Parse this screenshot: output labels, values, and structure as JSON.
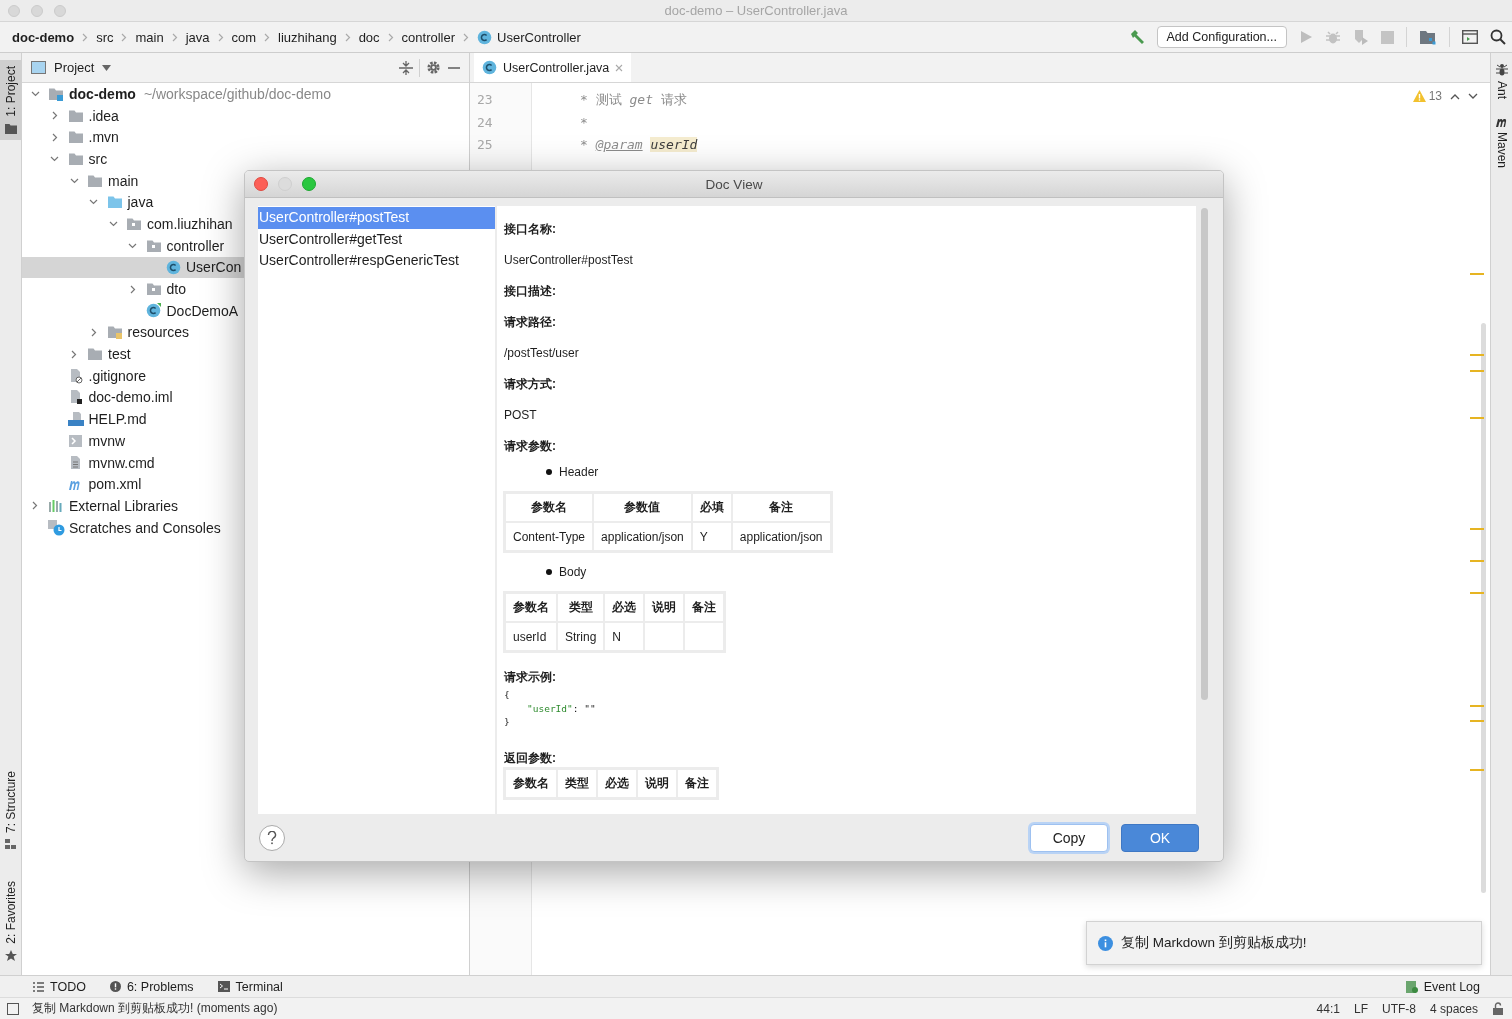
{
  "window": {
    "title": "doc-demo – UserController.java"
  },
  "breadcrumbs": [
    {
      "label": "doc-demo",
      "kind": "project"
    },
    {
      "label": "src",
      "kind": "folder"
    },
    {
      "label": "main",
      "kind": "folder"
    },
    {
      "label": "java",
      "kind": "folder"
    },
    {
      "label": "com",
      "kind": "folder"
    },
    {
      "label": "liuzhihang",
      "kind": "folder"
    },
    {
      "label": "doc",
      "kind": "folder"
    },
    {
      "label": "controller",
      "kind": "folder"
    },
    {
      "label": "UserController",
      "kind": "class"
    }
  ],
  "toolbar": {
    "configuration": "Add Configuration..."
  },
  "left_stripe": [
    {
      "label": "1: Project",
      "kind": "project",
      "selected": true
    },
    {
      "label": "7: Structure",
      "kind": "structure",
      "selected": false
    },
    {
      "label": "2: Favorites",
      "kind": "favorites",
      "selected": false
    }
  ],
  "right_stripe": [
    {
      "label": "Ant",
      "kind": "ant"
    },
    {
      "label": "Maven",
      "kind": "maven"
    }
  ],
  "project": {
    "title": "Project",
    "tree": [
      {
        "label": "doc-demo",
        "path": "~/workspace/github/doc-demo",
        "kind": "module",
        "expanded": true,
        "selected": false,
        "children": [
          {
            "label": ".idea",
            "kind": "folder",
            "expanded": false,
            "selected": false
          },
          {
            "label": ".mvn",
            "kind": "folder",
            "expanded": false,
            "selected": false
          },
          {
            "label": "src",
            "kind": "folder",
            "expanded": true,
            "selected": false,
            "children": [
              {
                "label": "main",
                "kind": "folder",
                "expanded": true,
                "selected": false,
                "children": [
                  {
                    "label": "java",
                    "kind": "source",
                    "expanded": true,
                    "selected": false,
                    "children": [
                      {
                        "label": "com.liuzhihan",
                        "kind": "package",
                        "expanded": true,
                        "selected": false,
                        "children": [
                          {
                            "label": "controller",
                            "kind": "package",
                            "expanded": true,
                            "selected": false,
                            "children": [
                              {
                                "label": "UserCon",
                                "kind": "class",
                                "selected": true
                              }
                            ]
                          },
                          {
                            "label": "dto",
                            "kind": "package",
                            "expanded": false,
                            "selected": false
                          },
                          {
                            "label": "DocDemoA",
                            "kind": "app",
                            "selected": false
                          }
                        ]
                      }
                    ]
                  },
                  {
                    "label": "resources",
                    "kind": "resources",
                    "expanded": false,
                    "selected": false
                  }
                ]
              },
              {
                "label": "test",
                "kind": "folder",
                "expanded": false,
                "selected": false
              }
            ]
          },
          {
            "label": ".gitignore",
            "kind": "ignore",
            "selected": false
          },
          {
            "label": "doc-demo.iml",
            "kind": "iml",
            "selected": false
          },
          {
            "label": "HELP.md",
            "kind": "md",
            "selected": false
          },
          {
            "label": "mvnw",
            "kind": "script",
            "selected": false
          },
          {
            "label": "mvnw.cmd",
            "kind": "text",
            "selected": false
          },
          {
            "label": "pom.xml",
            "kind": "maven",
            "selected": false
          }
        ]
      },
      {
        "label": "External Libraries",
        "kind": "libraries",
        "expanded": false,
        "selected": false
      },
      {
        "label": "Scratches and Consoles",
        "kind": "scratches",
        "selected": false
      }
    ]
  },
  "editor": {
    "tabs": [
      {
        "label": "UserController.java",
        "selected": true
      }
    ],
    "warnings": "13",
    "lines": [
      {
        "number": "23",
        "parts": [
          {
            "kind": "comment",
            "text": "* 测试 "
          },
          {
            "kind": "comment-italic",
            "text": "get"
          },
          {
            "kind": "comment",
            "text": " 请求"
          }
        ]
      },
      {
        "number": "24",
        "parts": [
          {
            "kind": "comment",
            "text": "*"
          }
        ]
      },
      {
        "number": "25",
        "parts": [
          {
            "kind": "comment",
            "text": "* "
          },
          {
            "kind": "doc-tag",
            "text": "@param"
          },
          {
            "kind": "doc-param",
            "text": "userId"
          }
        ]
      }
    ]
  },
  "dialog": {
    "title": "Doc View",
    "methods": [
      {
        "label": "UserController#postTest",
        "selected": true
      },
      {
        "label": "UserController#getTest",
        "selected": false
      },
      {
        "label": "UserController#respGenericTest",
        "selected": false
      }
    ],
    "doc": [
      {
        "kind": "heading",
        "text": "接口名称:"
      },
      {
        "kind": "text",
        "text": "UserController#postTest"
      },
      {
        "kind": "heading",
        "text": "接口描述:"
      },
      {
        "kind": "heading",
        "text": "请求路径:"
      },
      {
        "kind": "text",
        "text": "/postTest/user"
      },
      {
        "kind": "heading",
        "text": "请求方式:"
      },
      {
        "kind": "text",
        "text": "POST"
      },
      {
        "kind": "heading",
        "text": "请求参数:"
      },
      {
        "kind": "bullet",
        "text": "Header"
      },
      {
        "kind": "table",
        "columns": [
          "参数名",
          "参数值",
          "必填",
          "备注"
        ],
        "rows": [
          [
            "Content-Type",
            "application/json",
            "Y",
            "application/json"
          ]
        ]
      },
      {
        "kind": "bullet",
        "text": "Body"
      },
      {
        "kind": "table",
        "columns": [
          "参数名",
          "类型",
          "必选",
          "说明",
          "备注"
        ],
        "rows": [
          [
            "userId",
            "String",
            "N"
          ]
        ]
      },
      {
        "kind": "heading",
        "text": "请求示例:"
      },
      {
        "kind": "code",
        "open": "{",
        "entries": [
          {
            "key": "\"userId\"",
            "rest": ": \"\""
          }
        ],
        "close": "}"
      },
      {
        "kind": "heading",
        "text": "返回参数:"
      },
      {
        "kind": "table",
        "columns": [
          "参数名",
          "类型",
          "必选",
          "说明",
          "备注"
        ]
      }
    ],
    "buttons": [
      {
        "label": "Copy",
        "kind": "default"
      },
      {
        "label": "OK",
        "kind": "primary"
      }
    ]
  },
  "notification": {
    "text": "复制 Markdown 到剪贴板成功!",
    "kind": "info"
  },
  "tool_windows": [
    {
      "label": "TODO",
      "kind": "todo"
    },
    {
      "label": "6: Problems",
      "kind": "problems"
    },
    {
      "label": "Terminal",
      "kind": "terminal"
    }
  ],
  "event_log": {
    "label": "Event Log"
  },
  "status_bar": {
    "message": "复制 Markdown 到剪贴板成功! (moments ago)",
    "position": "44:1",
    "line_separator": "LF",
    "encoding": "UTF-8",
    "indent": "4 spaces"
  }
}
